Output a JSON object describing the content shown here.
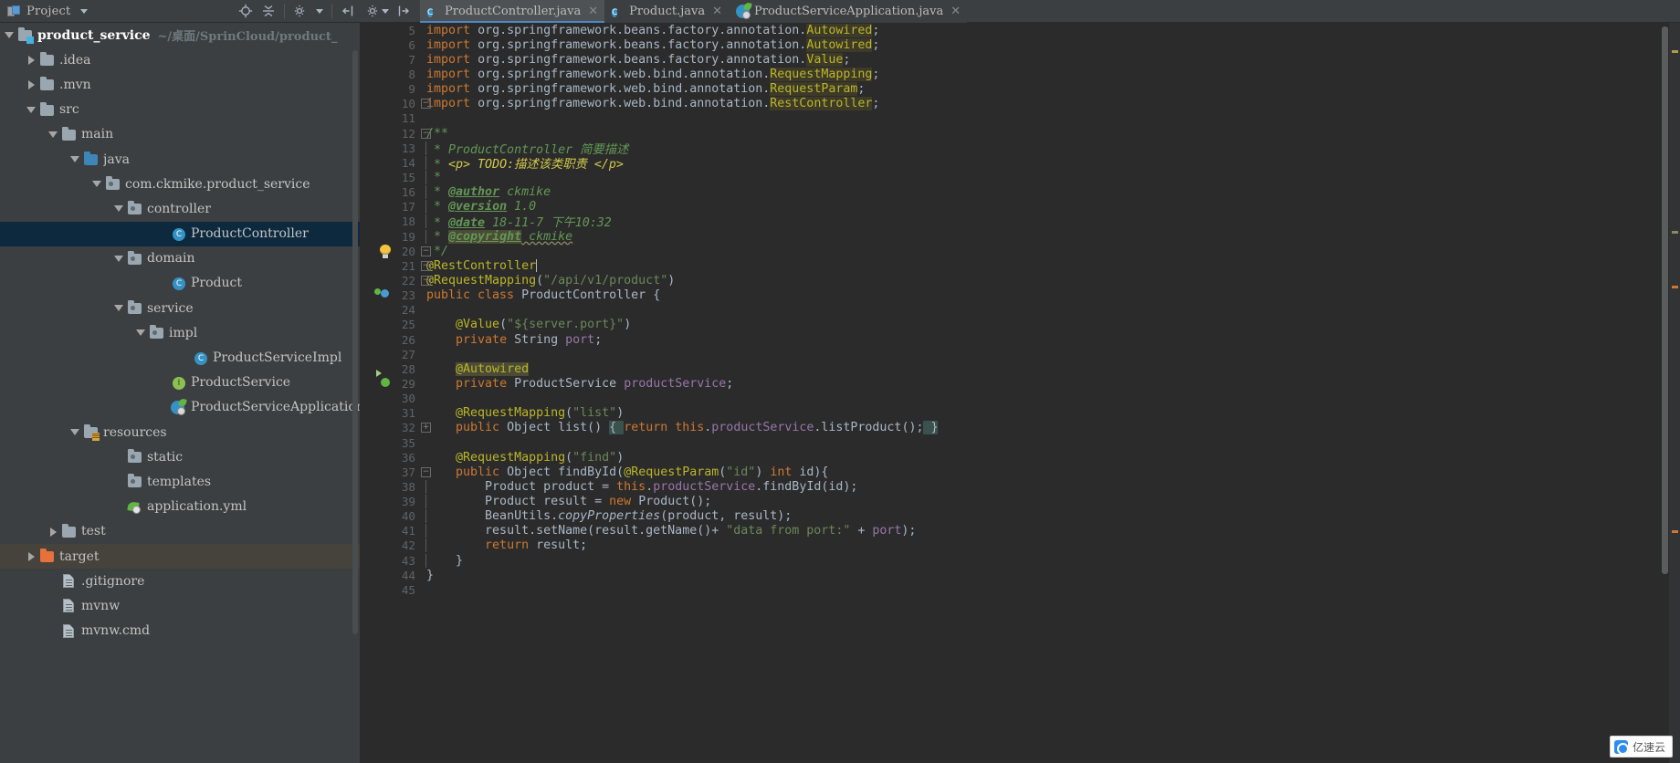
{
  "toolbar": {
    "project_label": "Project",
    "icons": [
      "project-icon",
      "dropdown-caret",
      "locate-icon",
      "collapse-all-icon",
      "settings-icon",
      "hide-icon",
      "jump-to-source-icon"
    ]
  },
  "tabs": [
    {
      "label": "ProductController.java",
      "icon": "java-class-icon",
      "active": true,
      "close": "✕"
    },
    {
      "label": "Product.java",
      "icon": "java-class-icon",
      "active": false,
      "close": "✕"
    },
    {
      "label": "ProductServiceApplication.java",
      "icon": "spring-boot-icon",
      "active": false,
      "close": "✕"
    }
  ],
  "tree": [
    {
      "label": "product_service",
      "path": "~/桌面/SprinCloud/product_",
      "icon": "module-folder",
      "indent": 0,
      "arrow": "open",
      "bold": true,
      "state": "normal"
    },
    {
      "label": ".idea",
      "icon": "folder-grey",
      "indent": 1,
      "arrow": "closed",
      "state": "normal"
    },
    {
      "label": ".mvn",
      "icon": "folder-grey",
      "indent": 1,
      "arrow": "closed",
      "state": "normal"
    },
    {
      "label": "src",
      "icon": "folder-grey",
      "indent": 1,
      "arrow": "open",
      "state": "normal"
    },
    {
      "label": "main",
      "icon": "folder-grey",
      "indent": 2,
      "arrow": "open",
      "state": "normal"
    },
    {
      "label": "java",
      "icon": "folder-blue",
      "indent": 3,
      "arrow": "open",
      "state": "normal"
    },
    {
      "label": "com.ckmike.product_service",
      "icon": "package-folder",
      "indent": 4,
      "arrow": "open",
      "state": "normal"
    },
    {
      "label": "controller",
      "icon": "package-folder",
      "indent": 5,
      "arrow": "open",
      "state": "normal"
    },
    {
      "label": "ProductController",
      "icon": "class-icon",
      "indent": 7,
      "arrow": "none",
      "state": "selected"
    },
    {
      "label": "domain",
      "icon": "package-folder",
      "indent": 5,
      "arrow": "open",
      "state": "normal"
    },
    {
      "label": "Product",
      "icon": "class-icon",
      "indent": 7,
      "arrow": "none",
      "state": "normal"
    },
    {
      "label": "service",
      "icon": "package-folder",
      "indent": 5,
      "arrow": "open",
      "state": "normal"
    },
    {
      "label": "impl",
      "icon": "package-folder",
      "indent": 6,
      "arrow": "open",
      "state": "normal"
    },
    {
      "label": "ProductServiceImpl",
      "icon": "class-icon",
      "indent": 8,
      "arrow": "none",
      "state": "normal"
    },
    {
      "label": "ProductService",
      "icon": "interface-icon",
      "indent": 7,
      "arrow": "none",
      "state": "normal"
    },
    {
      "label": "ProductServiceApplication",
      "icon": "spring-boot-icon",
      "indent": 7,
      "arrow": "none",
      "state": "normal"
    },
    {
      "label": "resources",
      "icon": "resources-folder",
      "indent": 3,
      "arrow": "open",
      "state": "normal"
    },
    {
      "label": "static",
      "icon": "package-folder",
      "indent": 5,
      "arrow": "none",
      "state": "normal"
    },
    {
      "label": "templates",
      "icon": "package-folder",
      "indent": 5,
      "arrow": "none",
      "state": "normal"
    },
    {
      "label": "application.yml",
      "icon": "spring-yaml-icon",
      "indent": 5,
      "arrow": "none",
      "state": "normal"
    },
    {
      "label": "test",
      "icon": "folder-grey",
      "indent": 2,
      "arrow": "closed",
      "state": "normal"
    },
    {
      "label": "target",
      "icon": "folder-orange",
      "indent": 1,
      "arrow": "closed",
      "state": "hovered"
    },
    {
      "label": ".gitignore",
      "icon": "file-icon",
      "indent": 2,
      "arrow": "none",
      "state": "normal"
    },
    {
      "label": "mvnw",
      "icon": "file-icon",
      "indent": 2,
      "arrow": "none",
      "state": "normal"
    },
    {
      "label": "mvnw.cmd",
      "icon": "file-icon",
      "indent": 2,
      "arrow": "none",
      "state": "normal"
    }
  ],
  "editor": {
    "first_visible_line": 5,
    "lines": [
      {
        "n": "5",
        "partial": true,
        "gmark": "",
        "fold": "",
        "html": "<span class=\"kw\">import</span> <span class=\"white\">org.springframework.beans.factory.annotation.</span><span class=\"clshl\">Autowired</span><span class=\"white\">;</span>"
      },
      {
        "n": "6",
        "gmark": "",
        "fold": "",
        "html": "<span class=\"kw\">import</span> <span class=\"white\">org.springframework.beans.factory.annotation.</span><span class=\"clshl\">Autowired</span><span class=\"white\">;</span>"
      },
      {
        "n": "7",
        "gmark": "",
        "fold": "",
        "html": "<span class=\"kw\">import</span> <span class=\"white\">org.springframework.beans.factory.annotation.</span><span class=\"clshl\">Value</span><span class=\"white\">;</span>"
      },
      {
        "n": "8",
        "gmark": "",
        "fold": "",
        "html": "<span class=\"kw\">import</span> <span class=\"white\">org.springframework.web.bind.annotation.</span><span class=\"clshl\">RequestMapping</span><span class=\"white\">;</span>"
      },
      {
        "n": "9",
        "gmark": "",
        "fold": "",
        "html": "<span class=\"kw\">import</span> <span class=\"white\">org.springframework.web.bind.annotation.</span><span class=\"clshl\">RequestParam</span><span class=\"white\">;</span>"
      },
      {
        "n": "10",
        "gmark": "",
        "fold": "minus",
        "html": "<span class=\"kw\">import</span> <span class=\"white\">org.springframework.web.bind.annotation.</span><span class=\"clshl\">RestController</span><span class=\"white\">;</span>"
      },
      {
        "n": "11",
        "gmark": "",
        "fold": "",
        "html": ""
      },
      {
        "n": "12",
        "gmark": "",
        "fold": "minus",
        "html": "<span class=\"cmt\">/**</span>"
      },
      {
        "n": "13",
        "gmark": "",
        "fold": "bar",
        "html": "<span class=\"cmt\"> * ProductController 简要描述</span>"
      },
      {
        "n": "14",
        "gmark": "",
        "fold": "bar",
        "html": "<span class=\"cmt\"> * </span><span class=\"cmtyellow\">&lt;p&gt; TODO:描述该类职责 &lt;/p&gt;</span>"
      },
      {
        "n": "15",
        "gmark": "",
        "fold": "bar",
        "html": "<span class=\"cmt\"> *</span>"
      },
      {
        "n": "16",
        "gmark": "",
        "fold": "bar",
        "html": "<span class=\"cmt\"> * </span><span class=\"doctag\">@author</span><span class=\"cmt\"> ckmike</span>"
      },
      {
        "n": "17",
        "gmark": "",
        "fold": "bar",
        "html": "<span class=\"cmt\"> * </span><span class=\"doctag\">@version</span><span class=\"cmt\"> 1.0</span>"
      },
      {
        "n": "18",
        "gmark": "",
        "fold": "bar",
        "html": "<span class=\"cmt\"> * </span><span class=\"doctag\">@date</span><span class=\"cmt\"> 18-11-7 下午10:32</span>"
      },
      {
        "n": "19",
        "gmark": "",
        "fold": "bar",
        "html": "<span class=\"cmt\"> * </span><span class=\"doctaghl\">@copyright</span><span class=\"cmt wavy\"> ckmike</span>"
      },
      {
        "n": "20",
        "gmark": "bulb",
        "fold": "minus",
        "html": "<span class=\"cmt\"> */</span>"
      },
      {
        "n": "21",
        "gmark": "",
        "fold": "minus",
        "html": "<span class=\"ann\">@RestController</span><span class=\"caret-holder\"></span>"
      },
      {
        "n": "22",
        "gmark": "",
        "fold": "minus",
        "html": "<span class=\"ann\">@RequestMapping</span><span class=\"white\">(</span><span class=\"str\">\"/api/v1/product\"</span><span class=\"white\">)</span>"
      },
      {
        "n": "23",
        "gmark": "bean",
        "fold": "",
        "html": "<span class=\"kw\">public class</span> <span class=\"white\">ProductController {</span>"
      },
      {
        "n": "24",
        "gmark": "",
        "fold": "",
        "html": ""
      },
      {
        "n": "25",
        "gmark": "",
        "fold": "",
        "html": "    <span class=\"ann\">@Value</span><span class=\"white\">(</span><span class=\"str\">\"${server.port}\"</span><span class=\"white\">)</span>"
      },
      {
        "n": "26",
        "gmark": "",
        "fold": "",
        "html": "    <span class=\"kw\">private</span> <span class=\"white\">String</span> <span class=\"fieldp\">port</span><span class=\"white\">;</span>"
      },
      {
        "n": "27",
        "gmark": "",
        "fold": "",
        "html": ""
      },
      {
        "n": "28",
        "gmark": "",
        "fold": "",
        "html": "    <span class=\"annhl\">@Autowired</span>"
      },
      {
        "n": "29",
        "gmark": "arrow",
        "fold": "",
        "html": "    <span class=\"kw\">private</span> <span class=\"white\">ProductService</span> <span class=\"fieldp\">productService</span><span class=\"white\">;</span>"
      },
      {
        "n": "30",
        "gmark": "",
        "fold": "",
        "html": ""
      },
      {
        "n": "31",
        "gmark": "",
        "fold": "",
        "html": "    <span class=\"ann\">@RequestMapping</span><span class=\"white\">(</span><span class=\"str\">\"list\"</span><span class=\"white\">)</span>"
      },
      {
        "n": "32",
        "gmark": "",
        "fold": "plus",
        "html": "    <span class=\"kw\">public</span> <span class=\"white\">Object list() </span><span class=\"braceHL\">{ </span><span class=\"kw\">return</span> <span class=\"kw\">this</span><span class=\"white\">.</span><span class=\"fieldp\">productService</span><span class=\"white\">.listProduct();</span><span class=\"braceHL\"> }</span>"
      },
      {
        "n": "35",
        "gmark": "",
        "fold": "",
        "html": ""
      },
      {
        "n": "36",
        "gmark": "",
        "fold": "",
        "html": "    <span class=\"ann\">@RequestMapping</span><span class=\"white\">(</span><span class=\"str\">\"find\"</span><span class=\"white\">)</span>"
      },
      {
        "n": "37",
        "gmark": "",
        "fold": "minus",
        "html": "    <span class=\"kw\">public</span> <span class=\"white\">Object findById(</span><span class=\"ann\">@RequestParam</span><span class=\"white\">(</span><span class=\"str\">\"id\"</span><span class=\"white\">) </span><span class=\"kw\">int</span> <span class=\"white\">id){</span>"
      },
      {
        "n": "38",
        "gmark": "",
        "fold": "bar",
        "html": "        <span class=\"white\">Product product = </span><span class=\"kw\">this</span><span class=\"white\">.</span><span class=\"fieldp\">productService</span><span class=\"white\">.findById(id);</span>"
      },
      {
        "n": "39",
        "gmark": "",
        "fold": "bar",
        "html": "        <span class=\"white\">Product result = </span><span class=\"kw\">new</span> <span class=\"white\">Product();</span>"
      },
      {
        "n": "40",
        "gmark": "",
        "fold": "bar",
        "html": "        <span class=\"white\">BeanUtils.</span><span class=\"cmt\" style=\"font-style:italic;color:#a9b7c6\">copyProperties</span><span class=\"white\">(product, result);</span>"
      },
      {
        "n": "41",
        "gmark": "",
        "fold": "bar",
        "html": "        <span class=\"white\">result.setName(result.getName()+ </span><span class=\"str\">\"data from port:\"</span><span class=\"white\"> + </span><span class=\"fieldp\">port</span><span class=\"white\">);</span>"
      },
      {
        "n": "42",
        "gmark": "",
        "fold": "bar",
        "html": "        <span class=\"kw\">return</span> <span class=\"white\">result;</span>"
      },
      {
        "n": "43",
        "gmark": "",
        "fold": "bar",
        "html": "    <span class=\"white\">}</span>"
      },
      {
        "n": "44",
        "gmark": "",
        "fold": "",
        "html": "<span class=\"white\">}</span>"
      },
      {
        "n": "45",
        "gmark": "",
        "fold": "",
        "html": ""
      }
    ]
  },
  "watermark": {
    "text": "亿速云"
  },
  "colors": {
    "background": "#3c3f41",
    "editor_background": "#2b2b2b",
    "selection": "#0d293e",
    "accent": "#4a88c7",
    "keyword": "#cc7832",
    "annotation": "#bbb529",
    "string": "#6a8759",
    "comment": "#629755",
    "field": "#9876aa",
    "text": "#a9b7c6"
  }
}
